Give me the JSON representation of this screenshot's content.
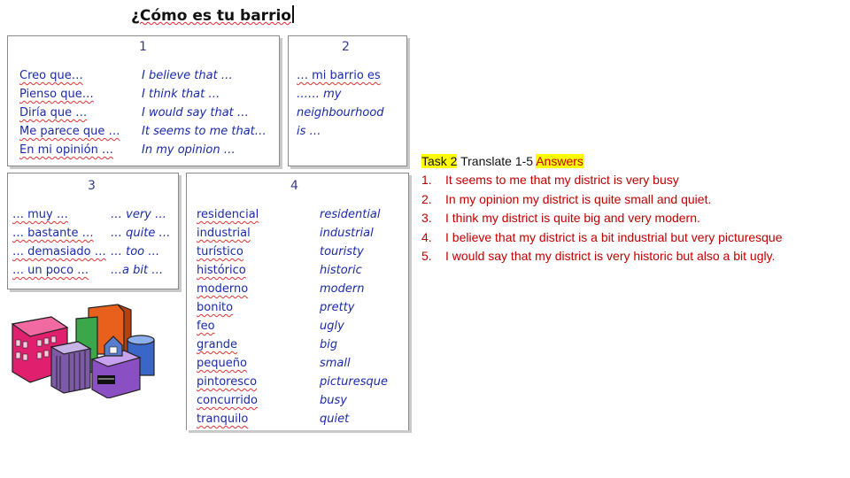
{
  "title": "¿Cómo es tu barrio",
  "box1": {
    "number": "1",
    "spanish": [
      "Creo que…",
      "Pienso que…",
      "Diría que …",
      "Me parece que …",
      "En mi opinión …"
    ],
    "english": [
      "I believe that …",
      "I think that …",
      "I would say that …",
      "It seems to me that…",
      "In my opinion …"
    ]
  },
  "box2": {
    "number": "2",
    "lines": [
      "… mi barrio es",
      "…… my",
      "neighbourhood",
      "is …"
    ]
  },
  "box3": {
    "number": "3",
    "spanish": [
      "… muy …",
      "… bastante …",
      "… demasiado …",
      "… un poco …"
    ],
    "english": [
      "… very …",
      "… quite …",
      "… too …",
      "…a bit …"
    ]
  },
  "box4": {
    "number": "4",
    "spanish": [
      "residencial",
      "industrial",
      "turístico",
      "histórico",
      "moderno",
      "bonito",
      "feo",
      "grande",
      "pequeño",
      "pintoresco",
      "concurrido",
      "tranquilo"
    ],
    "english": [
      "residential",
      "industrial",
      "touristy",
      "historic",
      "modern",
      "pretty",
      "ugly",
      "big",
      "small",
      "picturesque",
      "busy",
      "quiet"
    ]
  },
  "task": {
    "label": "Task 2",
    "instruction": "Translate 1-5",
    "answers_label": "Answers",
    "items": [
      {
        "num": "1.",
        "text": "It seems to me that my district is very busy"
      },
      {
        "num": "2.",
        "text": "In my opinion my district is quite small and quiet."
      },
      {
        "num": "3.",
        "text": "I think my district is quite big and very modern."
      },
      {
        "num": "4.",
        "text": "I believe that my district is a bit industrial but very picturesque"
      },
      {
        "num": "5.",
        "text": "I would say that my district is very historic but also a bit ugly."
      }
    ]
  },
  "colors": {
    "vocab": "#1a2aa8",
    "answers": "#c00000",
    "highlight": "#ffff00"
  },
  "icons": [
    "city-buildings-clipart"
  ]
}
